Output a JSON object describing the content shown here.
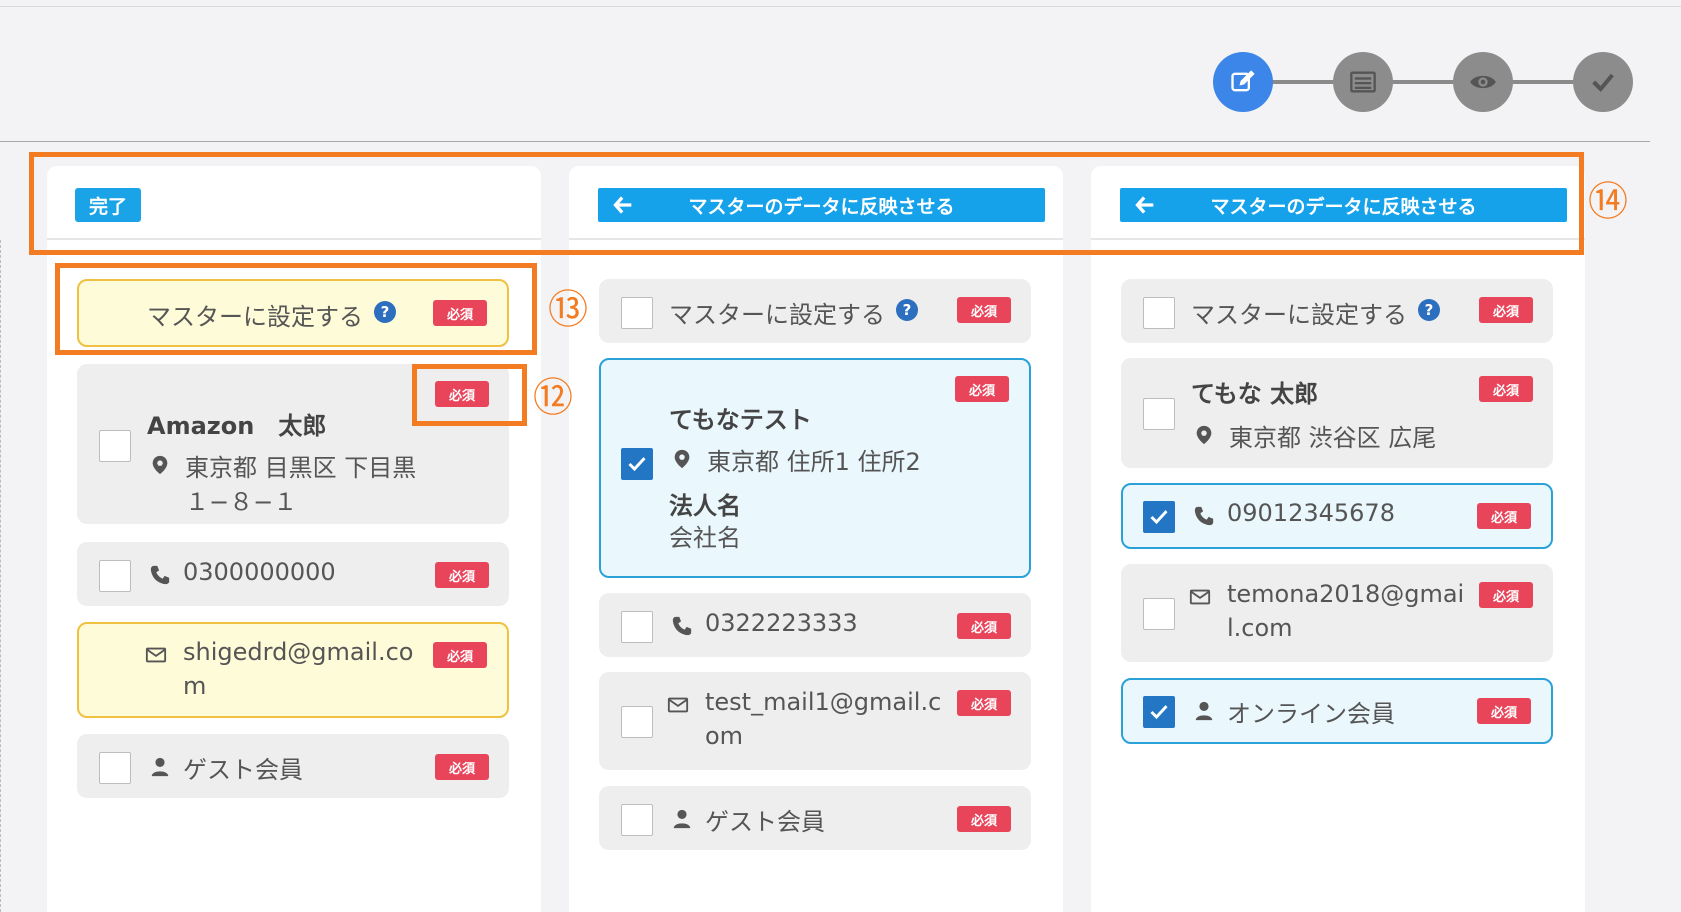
{
  "stepper": {
    "steps": [
      {
        "icon": "edit-icon",
        "active": true
      },
      {
        "icon": "list-icon",
        "active": false
      },
      {
        "icon": "eye-icon",
        "active": false
      },
      {
        "icon": "check-icon",
        "active": false
      }
    ]
  },
  "col1": {
    "done_label": "完了",
    "master_label": "マスターに設定する",
    "required": "必須",
    "address": {
      "name": "Amazon　太郎",
      "line1": "東京都 目黒区 下目黒",
      "line2": "１−８−１"
    },
    "phone": "0300000000",
    "email": {
      "line1": "shigedrd@gmail.co",
      "line2": "m"
    },
    "member": "ゲスト会員"
  },
  "col2": {
    "reflect_label": "マスターのデータに反映させる",
    "master_label": "マスターに設定する",
    "required": "必須",
    "address": {
      "name": "てもなテスト",
      "line1": "東京都 住所1 住所2",
      "corp_label": "法人名",
      "corp_value": "会社名"
    },
    "phone": "0322223333",
    "email": {
      "line1": "test_mail1@gmail.c",
      "line2": "om"
    },
    "member": "ゲスト会員"
  },
  "col3": {
    "reflect_label": "マスターのデータに反映させる",
    "master_label": "マスターに設定する",
    "required": "必須",
    "address": {
      "name": "てもな 太郎",
      "line1": "東京都 渋谷区 広尾"
    },
    "phone": "09012345678",
    "email": {
      "line1": "temona2018@gmai",
      "line2": "l.com"
    },
    "member": "オンライン会員"
  },
  "annotations": {
    "n12": "⑫",
    "n13": "⑬",
    "n14": "⑭"
  },
  "colors": {
    "accent": "#16a2ea",
    "required": "#e8445a",
    "annotation": "#f37c22",
    "stepper_active": "#3b86e8"
  }
}
